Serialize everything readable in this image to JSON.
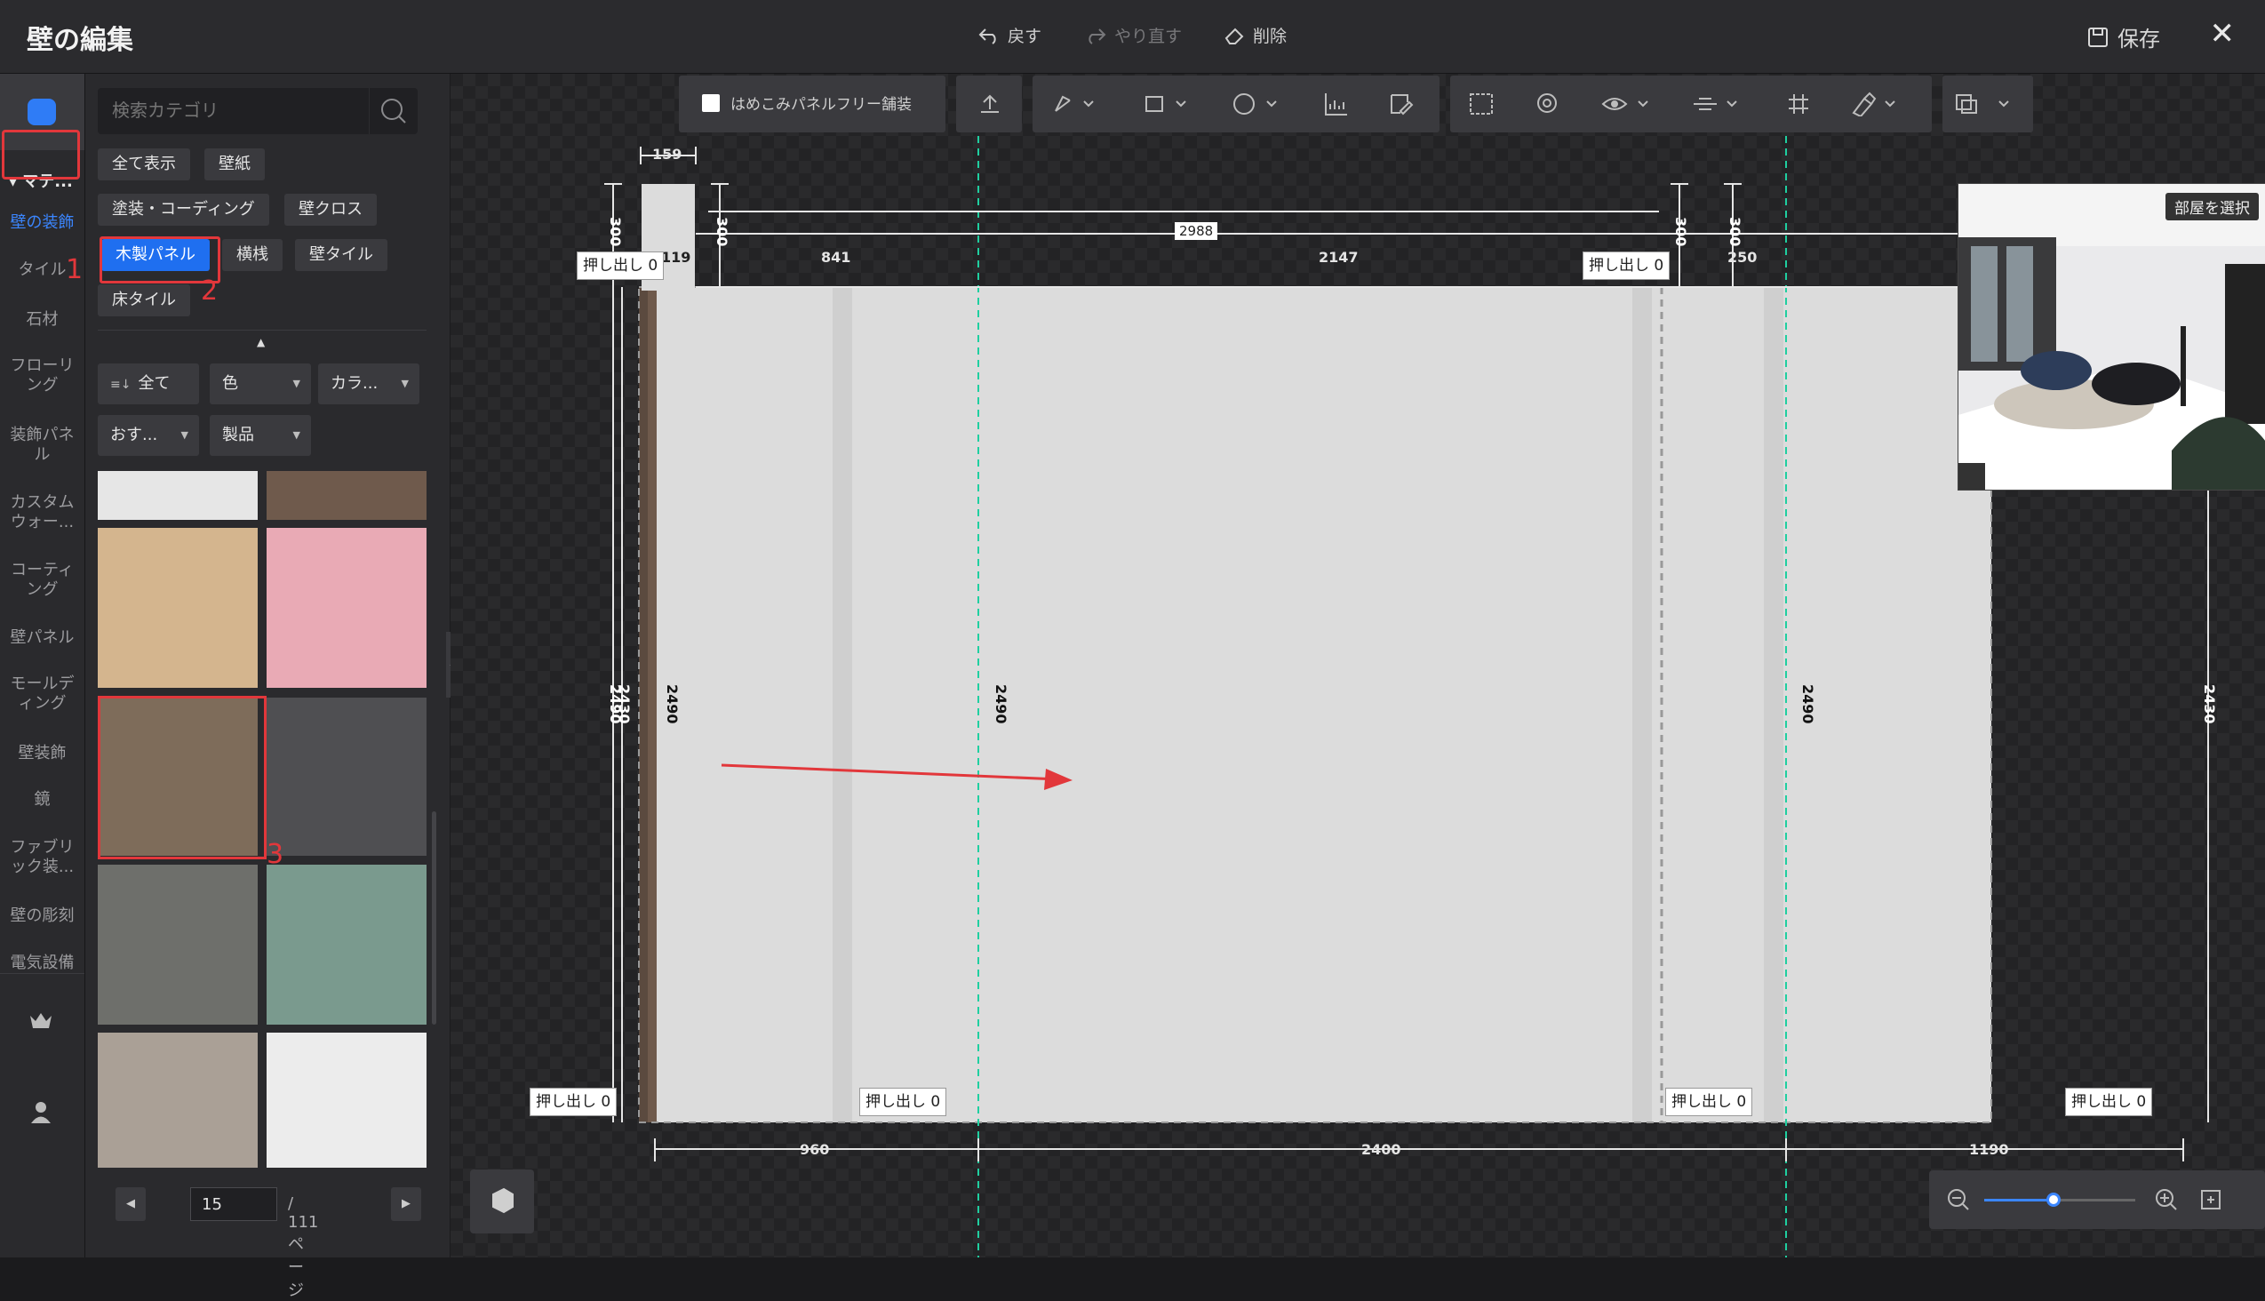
{
  "window": {
    "title": "壁の編集",
    "save_label": "保存"
  },
  "actions": {
    "undo": "戻す",
    "redo": "やり直す",
    "delete": "削除"
  },
  "rail": {
    "section": "▾ マテ...",
    "items": [
      "壁の装飾",
      "タイル",
      "石材",
      "フローリング",
      "装飾パネル",
      "カスタムウォー...",
      "コーティング",
      "壁パネル",
      "モールディング",
      "壁装飾",
      "鏡",
      "ファブリック装...",
      "壁の彫刻",
      "電気設備"
    ],
    "active_index": 0,
    "step_label_1": "1"
  },
  "panel": {
    "search_placeholder": "検索カテゴリ",
    "chips": [
      "全て表示",
      "壁紙",
      "塗装・コーディング",
      "壁クロス",
      "木製パネル",
      "横桟",
      "壁タイル",
      "床タイル"
    ],
    "active_chip": 4,
    "step_label_2": "2",
    "step_label_3": "3",
    "filters": {
      "all": "全て",
      "color": "色",
      "color2": "カラ...",
      "recommend": "おす...",
      "product": "製品"
    },
    "swatches": [
      "#e6e6e6",
      "#6f5a4c",
      "#d4b58e",
      "#e9aab5",
      "#7e6c5a",
      "#4f4f52",
      "#6e6f6b",
      "#7a9a8e",
      "#aaa096",
      "#ececec"
    ],
    "pager": {
      "current": "15",
      "total": "/ 111 ページ"
    }
  },
  "toolbar": {
    "free_panel": "はめこみパネルフリー舗装"
  },
  "dimensions": {
    "top_widths": [
      "159",
      "119",
      "841",
      "2988",
      "2147",
      "250"
    ],
    "heights": [
      "300",
      "300",
      "300",
      "300"
    ],
    "panel_height": "2490",
    "left_height_a": "2490",
    "left_height_b": "2430",
    "right_height": "2430",
    "bottom_widths": [
      "960",
      "2400",
      "1190"
    ],
    "push_label": "押し出し 0"
  },
  "preview": {
    "room_button": "部屋を選択"
  },
  "colors": {
    "accent": "#1f6ff0",
    "highlight": "#e2373b",
    "guide": "#1fcfa0"
  }
}
